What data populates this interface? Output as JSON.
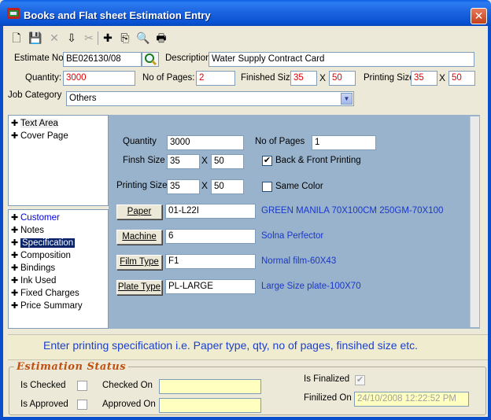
{
  "window": {
    "title": "Books and Flat sheet Estimation Entry",
    "close_glyph": "✕"
  },
  "toolbar": {
    "new": "🗋",
    "save": "💾",
    "delete": "✕",
    "import": "⇩",
    "cut": "✂",
    "add": "✚",
    "copy": "⎘",
    "preview": "🔍",
    "print": "🖶"
  },
  "header": {
    "estimate_no_label": "Estimate No:",
    "estimate_no": "BE026130/08",
    "description_label": "Description",
    "description": "Water Supply Contract Card",
    "quantity_label": "Quantity:",
    "quantity": "3000",
    "pages_label": "No of Pages:",
    "pages": "2",
    "finished_size_label": "Finished Size:",
    "finished_w": "35",
    "finished_h": "50",
    "printing_size_label": "Printing Size:",
    "printing_w": "35",
    "printing_h": "50",
    "times": "X",
    "job_category_label": "Job Category",
    "job_category": "Others"
  },
  "tree_top": [
    {
      "label": "Text Area"
    },
    {
      "label": "Cover Page"
    }
  ],
  "tree_bottom": [
    {
      "label": "Customer"
    },
    {
      "label": "Notes"
    },
    {
      "label": "Specification"
    },
    {
      "label": "Composition"
    },
    {
      "label": "Bindings"
    },
    {
      "label": "Ink Used"
    },
    {
      "label": "Fixed Charges"
    },
    {
      "label": "Price Summary"
    }
  ],
  "detail": {
    "quantity_label": "Quantity",
    "quantity": "3000",
    "pages_label": "No of Pages",
    "pages": "1",
    "finish_size_label": "Finsh Size",
    "finish_w": "35",
    "finish_h": "50",
    "back_front_label": "Back & Front Printing",
    "back_front_checked": "✔",
    "printing_size_label": "Printing Size",
    "printing_w": "35",
    "printing_h": "50",
    "same_color_label": "Same Color",
    "times": "X",
    "paper_btn": "Paper",
    "paper_code": "01-L22I",
    "paper_desc": "GREEN MANILA 70X100CM 250GM-70X100",
    "machine_btn": "Machine",
    "machine_code": "6",
    "machine_desc": "Solna Perfector",
    "film_btn": "Film Type",
    "film_code": "F1",
    "film_desc": "Normal film-60X43",
    "plate_btn": "Plate Type",
    "plate_code": "PL-LARGE",
    "plate_desc": "Large Size plate-100X70"
  },
  "hint": "Enter printing specification i.e. Paper type, qty, no of pages, finsihed size etc.",
  "status": {
    "title": "Estimation Status",
    "is_checked_label": "Is Checked",
    "checked_on_label": "Checked On",
    "checked_on": "",
    "is_approved_label": "Is Approved",
    "approved_on_label": "Approved On",
    "approved_on": "",
    "is_finalized_label": "Is Finalized",
    "finalized_check": "✔",
    "finalized_on_label": "Finilized On",
    "finalized_on": "24/10/2008 12:22:52 PM"
  },
  "colors": {
    "titlebar": "#0a5fe6",
    "detail_panel": "#99b3cc",
    "accent_red": "#e00000",
    "link_blue": "#1a38c8",
    "status_title": "#c05010"
  }
}
